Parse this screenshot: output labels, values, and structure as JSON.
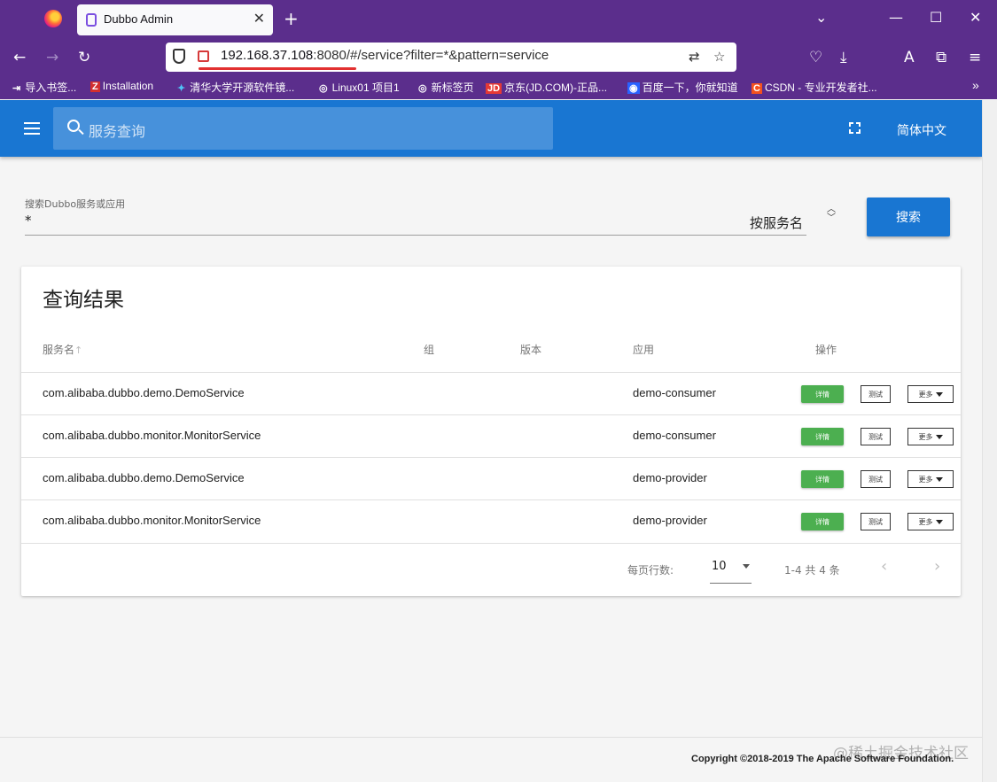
{
  "browser": {
    "tab_title": "Dubbo Admin",
    "url_host": "192.168.37.108",
    "url_rest": ":8080/#/service?filter=*&pattern=service",
    "bookmarks": [
      "导入书签...",
      "Installation",
      "清华大学开源软件镜...",
      "Linux01 项目1",
      "新标签页",
      "京东(JD.COM)-正品...",
      "百度一下，你就知道",
      "CSDN - 专业开发者社..."
    ]
  },
  "appbar": {
    "search_placeholder": "服务查询",
    "language": "简体中文"
  },
  "search": {
    "label": "搜索Dubbo服务或应用",
    "value": "*",
    "pattern": "按服务名",
    "button": "搜索"
  },
  "results": {
    "title": "查询结果",
    "headers": {
      "service": "服务名",
      "group": "组",
      "version": "版本",
      "app": "应用",
      "ops": "操作"
    },
    "rows": [
      {
        "service": "com.alibaba.dubbo.demo.DemoService",
        "app": "demo-consumer"
      },
      {
        "service": "com.alibaba.dubbo.monitor.MonitorService",
        "app": "demo-consumer"
      },
      {
        "service": "com.alibaba.dubbo.demo.DemoService",
        "app": "demo-provider"
      },
      {
        "service": "com.alibaba.dubbo.monitor.MonitorService",
        "app": "demo-provider"
      }
    ],
    "buttons": {
      "detail": "详情",
      "test": "测试",
      "more": "更多"
    },
    "pagination": {
      "rows_per_page_label": "每页行数:",
      "rows_per_page": "10",
      "range": "1-4 共 4 条"
    }
  },
  "footer": {
    "copyright": "Copyright ©2018-2019 The Apache Software Foundation.",
    "watermark": "@稀土掘金技术社区"
  }
}
